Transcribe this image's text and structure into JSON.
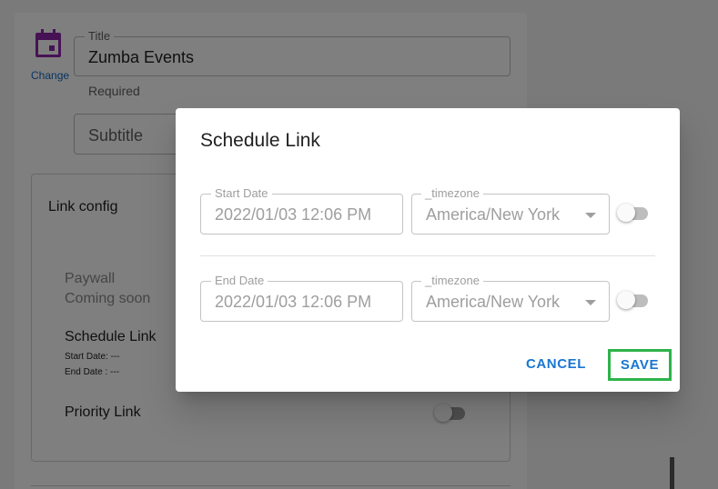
{
  "background": {
    "change_label": "Change",
    "title_field": {
      "label": "Title",
      "value": "Zumba Events",
      "helper": "Required"
    },
    "subtitle_field": {
      "placeholder": "Subtitle"
    },
    "link_config": {
      "heading": "Link config",
      "paywall": {
        "label": "Paywall",
        "note": "Coming soon"
      },
      "schedule": {
        "label": "Schedule Link",
        "start": "Start Date: ---",
        "end": "End Date : ---"
      },
      "priority": {
        "label": "Priority Link",
        "enabled": false
      }
    }
  },
  "dialog": {
    "title": "Schedule Link",
    "start": {
      "label": "Start Date",
      "value": "2022/01/03 12:06 PM",
      "timezone_label": "_timezone",
      "timezone": "America/New York",
      "enabled": false
    },
    "end": {
      "label": "End Date",
      "value": "2022/01/03 12:06 PM",
      "timezone_label": "_timezone",
      "timezone": "America/New York",
      "enabled": false
    },
    "cancel_label": "CANCEL",
    "save_label": "SAVE"
  },
  "colors": {
    "accent": "#1976d2",
    "icon": "#8e24aa",
    "highlight": "#2db34a"
  }
}
